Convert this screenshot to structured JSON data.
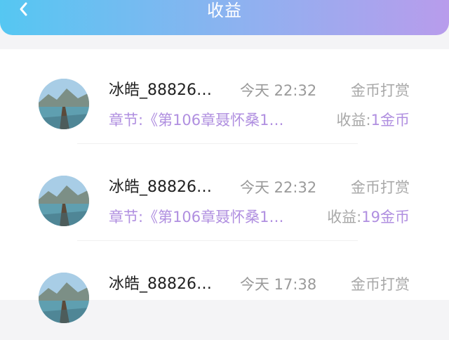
{
  "header": {
    "title": "收益",
    "back_icon": "chevron-left-icon"
  },
  "records": [
    {
      "name": "冰皓_88826…",
      "time": "今天 22:32",
      "type": "金币打赏",
      "chapter": "章节:《第106章聂怀桑1…",
      "earn_label": "收益:",
      "earn_value": "1金币"
    },
    {
      "name": "冰皓_88826…",
      "time": "今天 22:32",
      "type": "金币打赏",
      "chapter": "章节:《第106章聂怀桑1…",
      "earn_label": "收益:",
      "earn_value": "19金币"
    },
    {
      "name": "冰皓_88826…",
      "time": "今天 17:38",
      "type": "金币打赏",
      "chapter": "",
      "earn_label": "",
      "earn_value": ""
    }
  ],
  "colors": {
    "accent": "#b08fe0",
    "header_start": "#55c7f2",
    "header_end": "#b89cec"
  }
}
